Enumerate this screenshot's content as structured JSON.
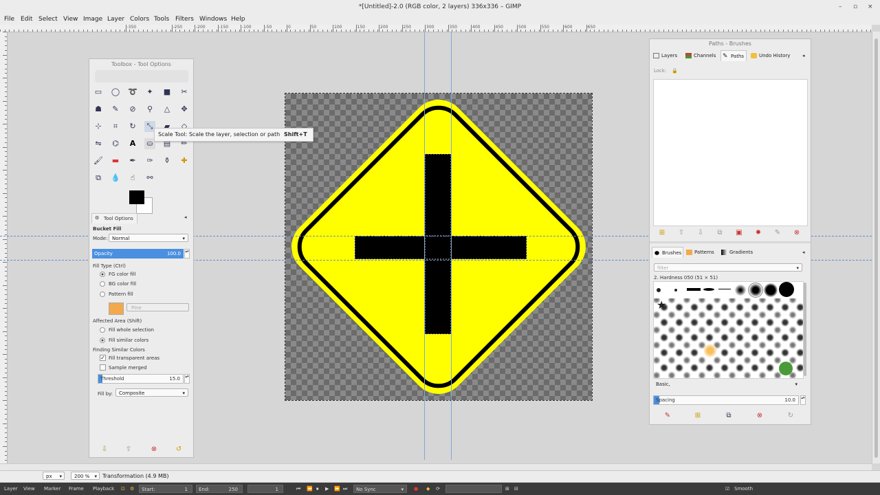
{
  "window": {
    "title": "*[Untitled]-2.0 (RGB color, 2 layers) 336x336 – GIMP",
    "controls": [
      "–",
      "▫",
      "×"
    ]
  },
  "menu": [
    "File",
    "Edit",
    "Select",
    "View",
    "Image",
    "Layer",
    "Colors",
    "Tools",
    "Filters",
    "Windows",
    "Help"
  ],
  "ruler": {
    "labels": [
      "-350",
      "-250",
      "-200",
      "-150",
      "-100",
      "-50",
      "0",
      "50",
      "100",
      "150",
      "200",
      "250",
      "300",
      "350",
      "400",
      "450",
      "500",
      "550",
      "600",
      "650"
    ]
  },
  "toolbox": {
    "title": "Toolbox - Tool Options",
    "tooltip": {
      "text": "Scale Tool: Scale the layer, selection or path",
      "shortcut": "Shift+T"
    },
    "fg_color": "#000000",
    "bg_color": "#ffffff"
  },
  "tool_options": {
    "tab_label": "Tool Options",
    "tool_name": "Bucket Fill",
    "mode_label": "Mode:",
    "mode_value": "Normal",
    "opacity_label": "Opacity",
    "opacity_value": "100.0",
    "fill_type_label": "Fill Type  (Ctrl)",
    "fill_fg": "FG color fill",
    "fill_bg": "BG color fill",
    "fill_pattern": "Pattern fill",
    "pattern_name": "Pine",
    "affected_label": "Affected Area  (Shift)",
    "fill_whole": "Fill whole selection",
    "fill_similar": "Fill similar colors",
    "finding_label": "Finding Similar Colors",
    "fill_transparent": "Fill transparent areas",
    "sample_merged": "Sample merged",
    "threshold_label": "Threshold",
    "threshold_value": "15.0",
    "fill_by_label": "Fill by:",
    "fill_by_value": "Composite"
  },
  "paths_dock": {
    "title": "Paths - Brushes",
    "tabs": [
      "Layers",
      "Channels",
      "Paths",
      "Undo History"
    ],
    "lock_label": "Lock:"
  },
  "brushes_dock": {
    "tabs": [
      "Brushes",
      "Patterns",
      "Gradients"
    ],
    "filter_placeholder": "filter",
    "brush_name": "2. Hardness 050 (51 × 51)",
    "preset": "Basic,",
    "spacing_label": "Spacing",
    "spacing_value": "10.0"
  },
  "status": {
    "unit": "px",
    "zoom": "200 %",
    "message": "Transformation (4.9 MB)"
  },
  "timeline": {
    "layer": "Layer",
    "view": "View",
    "marker": "Marker",
    "frame": "Frame",
    "playback": "Playback",
    "start_label": "Start:",
    "start_value": "1",
    "end_label": "End:",
    "end_value": "250",
    "current": "1",
    "sync": "No Sync",
    "smooth": "Smooth"
  },
  "colors": {
    "sign_yellow": "#ffff00",
    "sign_black": "#000000",
    "accent": "#4a8fe0"
  }
}
